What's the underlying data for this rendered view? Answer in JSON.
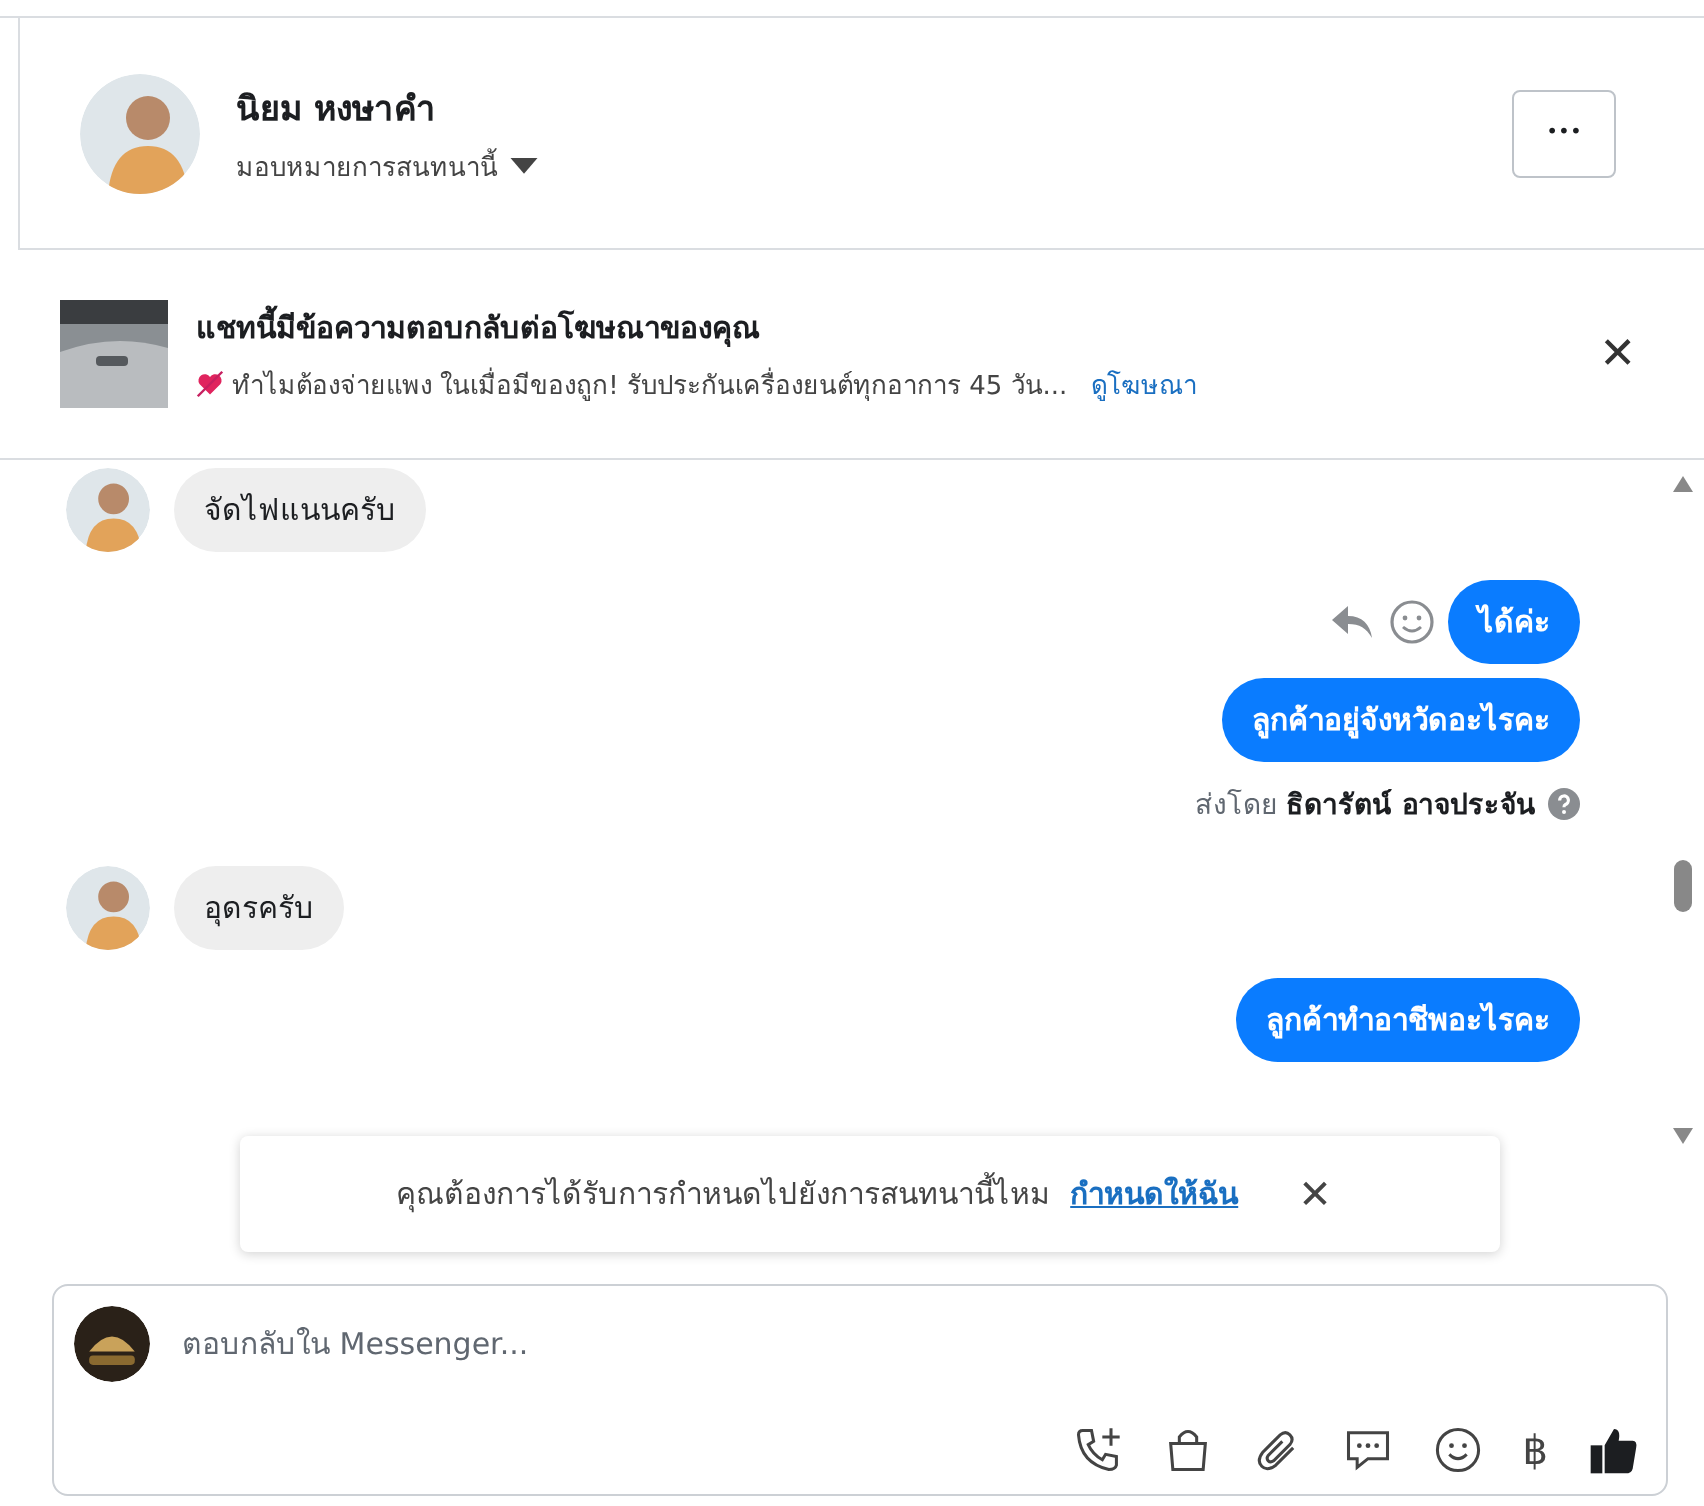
{
  "header": {
    "name": "นิยม หงษาคำ",
    "assign_label": "มอบหมายการสนทนานี้",
    "more_button": "•••"
  },
  "ad_banner": {
    "title": "แชทนี้มีข้อความตอบกลับต่อโฆษณาของคุณ",
    "snippet": "ทำไมต้องจ่ายแพง ในเมื่อมีของถูก! รับประกันเครื่องยนต์ทุกอาการ 45 วัน...",
    "link": "ดูโฆษณา",
    "close": "✕"
  },
  "messages": [
    {
      "kind": "incoming",
      "text": "จัดไฟแนนครับ"
    },
    {
      "kind": "outgoing",
      "text": "ได้ค่ะ",
      "actions": true
    },
    {
      "kind": "outgoing",
      "text": "ลูกค้าอยู่จังหวัดอะไรคะ"
    },
    {
      "kind": "sent_by",
      "text": "ส่งโดย **ธิดารัตน์ อาจประจัน**"
    },
    {
      "kind": "incoming",
      "text": "อุดรครับ"
    },
    {
      "kind": "outgoing",
      "text": "ลูกค้าทำอาชีพอะไรคะ"
    }
  ],
  "toast": {
    "text": "คุณต้องการได้รับการกำหนดไปยังการสนทนานี้ไหม",
    "link": "กำหนดให้ฉัน",
    "close": "✕"
  },
  "composer": {
    "placeholder": "ตอบกลับใน Messenger...",
    "currency": "฿"
  }
}
